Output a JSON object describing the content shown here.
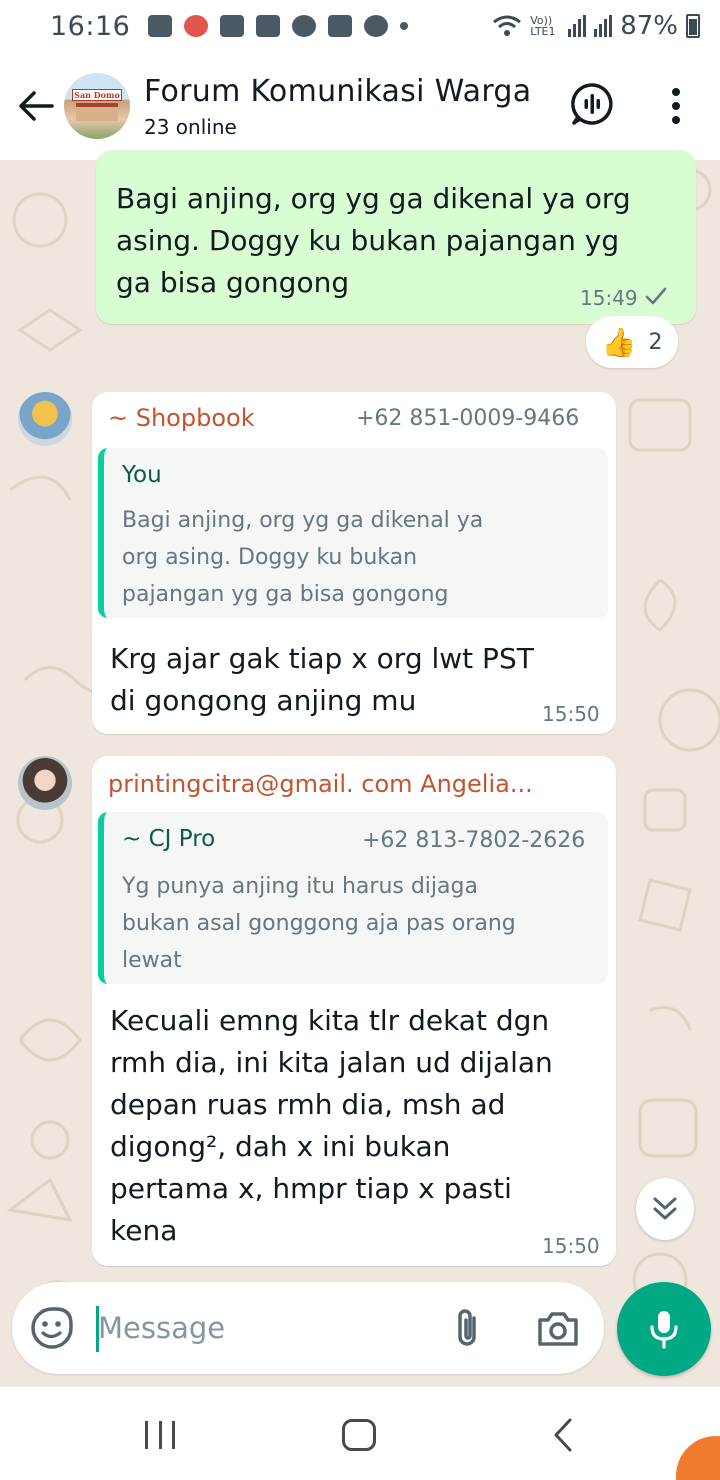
{
  "status_bar": {
    "time": "16:16",
    "network": "Vo)) LTE1",
    "battery": "87%"
  },
  "header": {
    "title": "Forum Komunikasi Warga",
    "subtitle": "23 online",
    "avatar_sign": "San Domo"
  },
  "messages": {
    "m1": {
      "direction": "outgoing",
      "text_lines": [
        "Bagi anjing, org yg ga dikenal ya org",
        "asing. Doggy ku bukan pajangan yg",
        "ga bisa gongong"
      ],
      "time": "15:49",
      "status": "sent",
      "reaction_emoji": "👍",
      "reaction_count": "2"
    },
    "m2": {
      "direction": "incoming",
      "sender": "~ Shopbook",
      "phone": "+62 851-0009-9466",
      "quote_name": "You",
      "quote_lines": [
        "Bagi anjing, org yg ga dikenal ya",
        "org asing. Doggy ku bukan",
        "pajangan yg ga bisa gongong"
      ],
      "text_lines": [
        "Krg ajar gak tiap x org lwt PST",
        "di gongong anjing mu"
      ],
      "time": "15:50"
    },
    "m3": {
      "direction": "incoming",
      "sender": "printingcitra@gmail. com Angelia...",
      "quote_name": "~ CJ Pro",
      "quote_phone": "+62 813-7802-2626",
      "quote_lines": [
        "Yg punya anjing itu harus dijaga",
        "bukan asal gonggong aja pas orang",
        "lewat"
      ],
      "text_lines": [
        "Kecuali emng kita tlr dekat dgn",
        "rmh dia, ini kita jalan ud dijalan",
        "depan ruas rmh dia, msh ad",
        "digong², dah x ini bukan",
        "pertama x, hmpr tiap x pasti",
        "kena"
      ],
      "time": "15:50"
    }
  },
  "composer": {
    "placeholder": "Message"
  },
  "icons": {
    "back": "arrow-left-icon",
    "call": "voice-chat-icon",
    "menu": "more-vert-icon",
    "emoji": "sticker-icon",
    "attach": "paperclip-icon",
    "camera": "camera-icon",
    "mic": "mic-icon",
    "scroll": "double-chevron-down-icon"
  },
  "colors": {
    "accent": "#00a884",
    "outgoing_bubble": "#d9fdd3",
    "sender_name": "#c3552e",
    "quote_you": "#0b5a4a",
    "quote_bar": "#06cf9c"
  }
}
